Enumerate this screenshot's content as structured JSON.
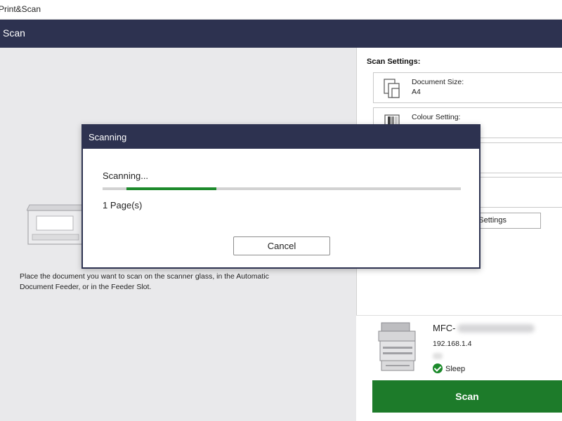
{
  "app": {
    "title": "Print&Scan"
  },
  "header": {
    "title": "Scan"
  },
  "left": {
    "instructions": "Place the document you want to scan on the scanner glass, in the Automatic Document Feeder, or in the Feeder Slot."
  },
  "settings": {
    "label": "Scan Settings:",
    "items": [
      {
        "label": "Document Size:",
        "value": "A4",
        "icon": "document-size-icon"
      },
      {
        "label": "Colour Setting:",
        "value": "",
        "icon": "colour-setting-icon"
      },
      {
        "label": "",
        "value": "",
        "icon": ""
      },
      {
        "label": "",
        "value": "",
        "icon": ""
      }
    ],
    "more_button": "Settings"
  },
  "device": {
    "name": "MFC-",
    "ip": "192.168.1.4",
    "status": "Sleep",
    "status_icon": "check-circle-icon",
    "status_color": "#1c8a2b"
  },
  "scan_button": "Scan",
  "colors": {
    "header": "#2d3250",
    "accent_green": "#1d7b2a"
  },
  "dialog": {
    "title": "Scanning",
    "status": "Scanning...",
    "pages": "1 Page(s)",
    "progress_percent": 25,
    "cancel_label": "Cancel"
  }
}
